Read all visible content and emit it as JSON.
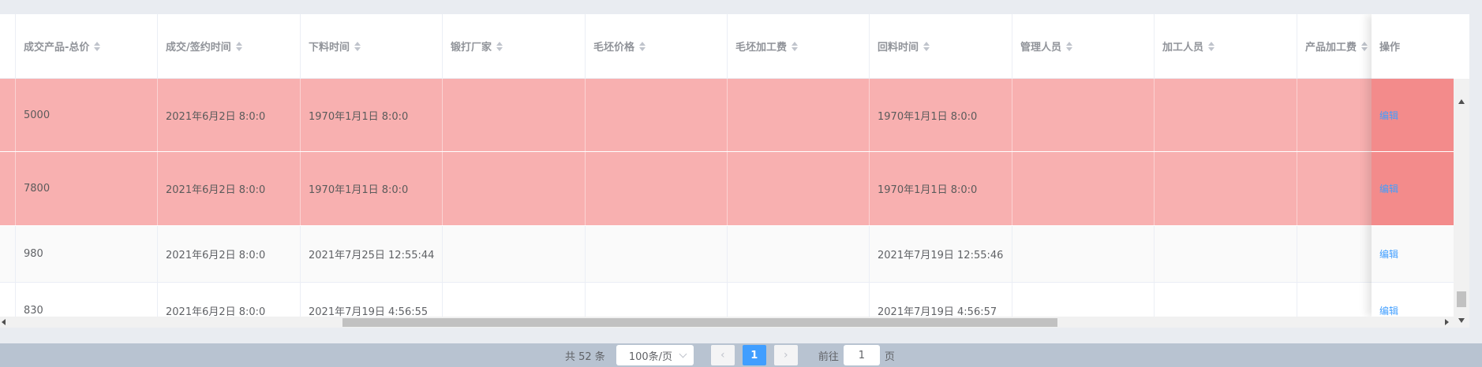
{
  "table": {
    "columns": [
      "成交产品-总价",
      "成交/签约时间",
      "下料时间",
      "锻打厂家",
      "毛坯价格",
      "毛坯加工费",
      "回料时间",
      "管理人员",
      "加工人员",
      "产品加工费"
    ],
    "action_header": "操作",
    "rows": [
      {
        "cells": [
          "5000",
          "2021年6月2日 8:0:0",
          "1970年1月1日 8:0:0",
          "",
          "",
          "",
          "1970年1月1日 8:0:0",
          "",
          "",
          ""
        ],
        "action": "编辑"
      },
      {
        "cells": [
          "7800",
          "2021年6月2日 8:0:0",
          "1970年1月1日 8:0:0",
          "",
          "",
          "",
          "1970年1月1日 8:0:0",
          "",
          "",
          ""
        ],
        "action": "编辑"
      },
      {
        "cells": [
          "980",
          "2021年6月2日 8:0:0",
          "2021年7月25日 12:55:44",
          "",
          "",
          "",
          "2021年7月19日 12:55:46",
          "",
          "",
          ""
        ],
        "action": "编辑"
      },
      {
        "cells": [
          "830",
          "2021年6月2日 8:0:0",
          "2021年7月19日 4:56:55",
          "",
          "",
          "",
          "2021年7月19日 4:56:57",
          "",
          "",
          ""
        ],
        "action": "编辑"
      }
    ],
    "highlight_color": "#f8b0b0"
  },
  "pagination": {
    "total": "共 52 条",
    "page_size": "100条/页",
    "prev": "‹",
    "current_page": "1",
    "next": "›",
    "goto_prefix": "前往",
    "goto_value": "1",
    "goto_suffix": "页"
  },
  "colors": {
    "accent": "#409eff",
    "highlight_row": "#f8b0b0",
    "highlight_fixed": "#f38b8b"
  }
}
